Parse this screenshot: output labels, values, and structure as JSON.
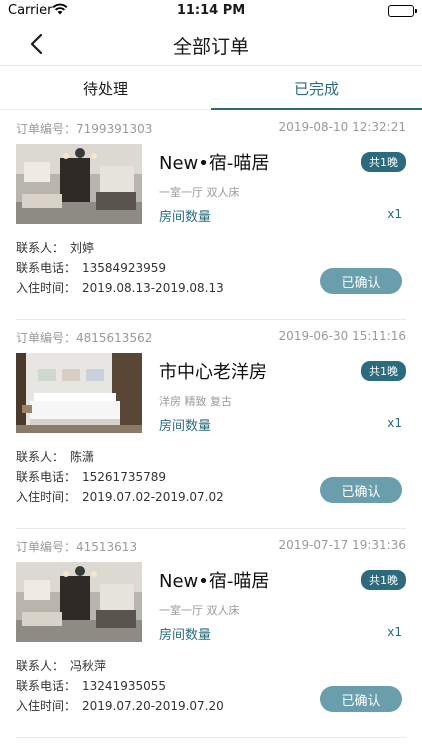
{
  "status_bar": {
    "carrier": "Carrier",
    "time": "11:14 PM"
  },
  "nav": {
    "title": "全部订单"
  },
  "tabs": [
    {
      "label": "待处理",
      "active": false
    },
    {
      "label": "已完成",
      "active": true
    }
  ],
  "colors": {
    "accent": "#2b6b7d",
    "button": "#6a9eac",
    "muted": "#9a9a9a"
  },
  "orders": [
    {
      "order_no_label": "订单编号：7199391303",
      "date": "2019-08-10 12:32:21",
      "name": "New•宿-喵居",
      "nights": "共1晚",
      "tags": "一室一厅 双人床",
      "qty_label": "房间数量",
      "qty_value": "x1",
      "contact_label": "联系人：",
      "contact": "刘婷",
      "phone_label": "联系电话：",
      "phone": "13584923959",
      "checkin_label": "入住时间：",
      "checkin": "2019.08.13-2019.08.13",
      "button": "已确认"
    },
    {
      "order_no_label": "订单编号：4815613562",
      "date": "2019-06-30 15:11:16",
      "name": "市中心老洋房",
      "nights": "共1晚",
      "tags": "洋房 精致 复古",
      "qty_label": "房间数量",
      "qty_value": "x1",
      "contact_label": "联系人：",
      "contact": "陈潇",
      "phone_label": "联系电话：",
      "phone": "15261735789",
      "checkin_label": "入住时间：",
      "checkin": "2019.07.02-2019.07.02",
      "button": "已确认"
    },
    {
      "order_no_label": "订单编号：41513613",
      "date": "2019-07-17 19:31:36",
      "name": "New•宿-喵居",
      "nights": "共1晚",
      "tags": "一室一厅 双人床",
      "qty_label": "房间数量",
      "qty_value": "x1",
      "contact_label": "联系人：",
      "contact": "冯秋萍",
      "phone_label": "联系电话：",
      "phone": "13241935055",
      "checkin_label": "入住时间：",
      "checkin": "2019.07.20-2019.07.20",
      "button": "已确认"
    }
  ]
}
